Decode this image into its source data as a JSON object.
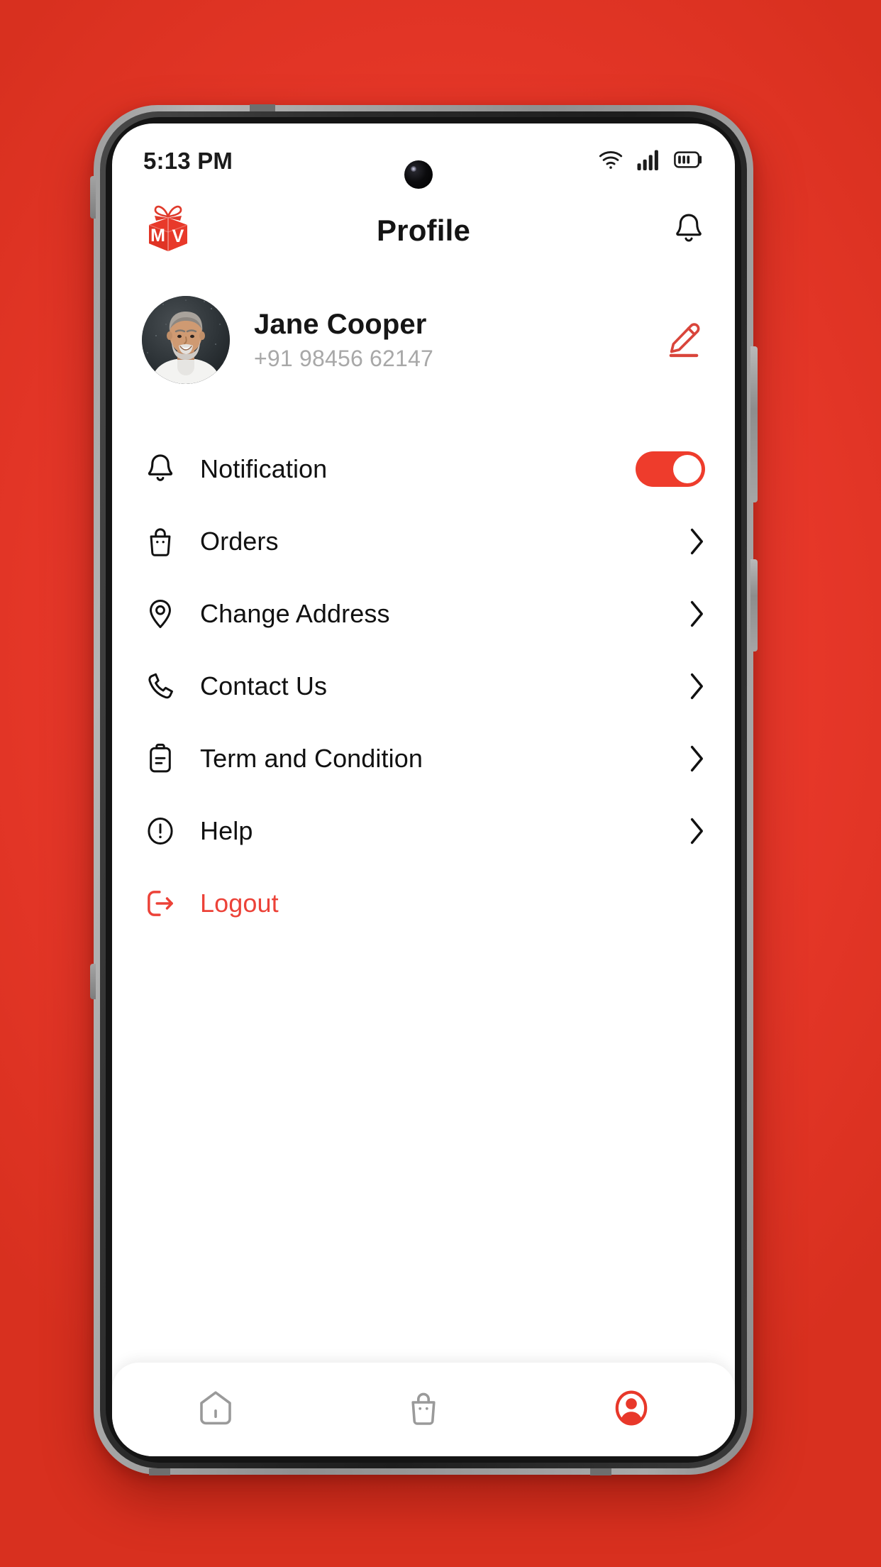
{
  "theme": {
    "background_red": "#E8382A",
    "accent_red": "#EC4238",
    "toggle_on_red": "#EE3C2C",
    "text_primary": "#111111",
    "text_muted": "#A8A8A8"
  },
  "status_bar": {
    "time": "5:13 PM",
    "icons": [
      "wifi-icon",
      "cellular-signal-icon",
      "battery-icon"
    ]
  },
  "header": {
    "logo_name": "mv-gift-box-logo",
    "logo_letters": "MV",
    "title": "Profile",
    "notification_icon": "bell-icon"
  },
  "profile": {
    "avatar_name": "user-avatar",
    "name": "Jane Cooper",
    "phone": "+91 98456 62147",
    "edit_icon": "edit-pencil-icon"
  },
  "menu": {
    "items": [
      {
        "label": "Notification",
        "icon": "bell-icon",
        "control": "toggle",
        "toggle_on": true
      },
      {
        "label": "Orders",
        "icon": "shopping-bag-icon",
        "control": "chevron"
      },
      {
        "label": "Change Address",
        "icon": "map-pin-icon",
        "control": "chevron"
      },
      {
        "label": "Contact Us",
        "icon": "phone-icon",
        "control": "chevron"
      },
      {
        "label": "Term and Condition",
        "icon": "clipboard-text-icon",
        "control": "chevron"
      },
      {
        "label": "Help",
        "icon": "info-circle-icon",
        "control": "chevron"
      },
      {
        "label": "Logout",
        "icon": "logout-icon",
        "control": "none",
        "danger": true
      }
    ]
  },
  "bottom_nav": {
    "items": [
      {
        "name": "home",
        "icon": "home-icon",
        "active": false
      },
      {
        "name": "bag",
        "icon": "shopping-bag-icon",
        "active": false
      },
      {
        "name": "profile",
        "icon": "user-circle-icon",
        "active": true
      }
    ]
  }
}
